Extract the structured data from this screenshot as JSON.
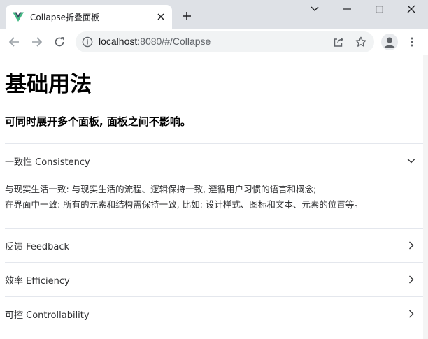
{
  "browser": {
    "tab_title": "Collapse折叠面板",
    "url_host": "localhost",
    "url_path": ":8080/#/Collapse"
  },
  "page": {
    "title": "基础用法",
    "subtitle": "可同时展开多个面板, 面板之间不影响。"
  },
  "collapse": {
    "items": [
      {
        "title": "一致性 Consistency",
        "expanded": true,
        "content": [
          "与现实生活一致: 与现实生活的流程、逻辑保持一致, 遵循用户习惯的语言和概念;",
          "在界面中一致: 所有的元素和结构需保持一致, 比如: 设计样式、图标和文本、元素的位置等。"
        ]
      },
      {
        "title": "反馈 Feedback",
        "expanded": false
      },
      {
        "title": "效率 Efficiency",
        "expanded": false
      },
      {
        "title": "可控 Controllability",
        "expanded": false
      }
    ]
  },
  "colors": {
    "tabstrip": "#dee1e6",
    "divider": "#e4e7ed",
    "vue_green": "#42b883",
    "vue_dark": "#35495e"
  },
  "icons": [
    "vue-logo-icon",
    "close-icon",
    "plus-icon",
    "chevron-down-icon",
    "minimize-icon",
    "maximize-icon",
    "window-close-icon",
    "back-arrow-icon",
    "forward-arrow-icon",
    "reload-icon",
    "info-icon",
    "share-icon",
    "star-icon",
    "profile-icon",
    "kebab-menu-icon",
    "chevron-right-icon"
  ]
}
